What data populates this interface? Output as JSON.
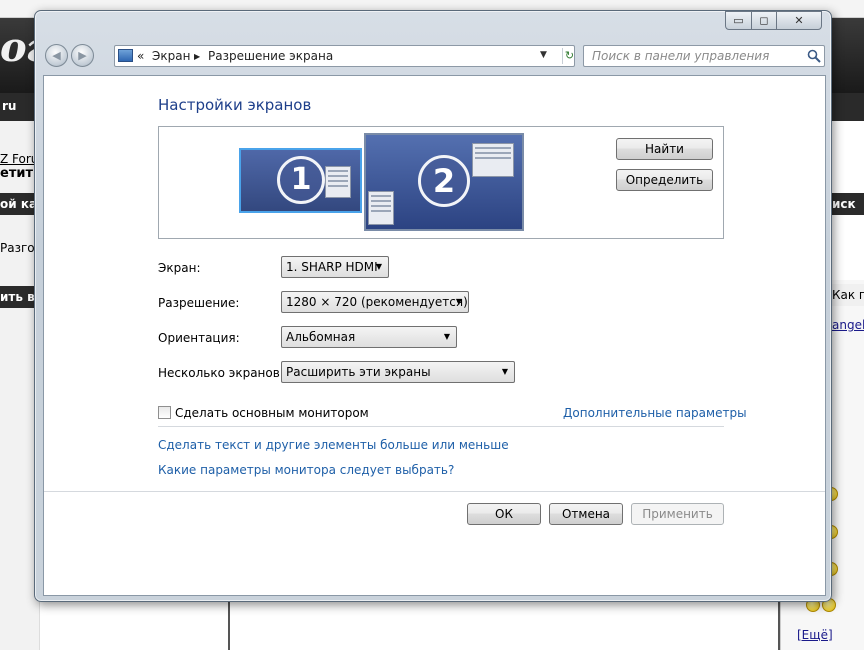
{
  "background_page": {
    "logo": "огл",
    "nav_text": "ru",
    "forum_text": "Z Foru",
    "bar1": "етиты",
    "bar2": "ой кат",
    "crumb": "Разго",
    "bar3": "ить в",
    "right_bar1": "иск",
    "right_text": "Как п",
    "right_link": "angel-",
    "more_link": "[Ещё]"
  },
  "window": {
    "controls": {
      "minimize": "▭",
      "maximize": "◻",
      "close": "✕"
    },
    "nav": {
      "back": "◀",
      "forward": "▶"
    },
    "address": {
      "prefix": "«",
      "crumbs": [
        "Экран",
        "Разрешение экрана"
      ],
      "separator": "▶"
    },
    "search_placeholder": "Поиск в панели управления"
  },
  "content": {
    "title": "Настройки экранов",
    "monitors": [
      {
        "number": "1"
      },
      {
        "number": "2"
      }
    ],
    "buttons": {
      "detect": "Найти",
      "identify": "Определить"
    },
    "fields": [
      {
        "label": "Экран:",
        "value": "1. SHARP HDMI"
      },
      {
        "label": "Разрешение:",
        "value": "1280 × 720 (рекомендуется)"
      },
      {
        "label": "Ориентация:",
        "value": "Альбомная"
      },
      {
        "label": "Несколько экранов:",
        "value": "Расширить эти экраны"
      }
    ],
    "primary_checkbox": "Сделать основным монитором",
    "checkbox_checked": false,
    "advanced_link": "Дополнительные параметры",
    "links": [
      "Сделать текст и другие элементы больше или меньше",
      "Какие параметры монитора следует выбрать?"
    ],
    "dialog": {
      "ok": "ОК",
      "cancel": "Отмена",
      "apply": "Применить"
    }
  }
}
